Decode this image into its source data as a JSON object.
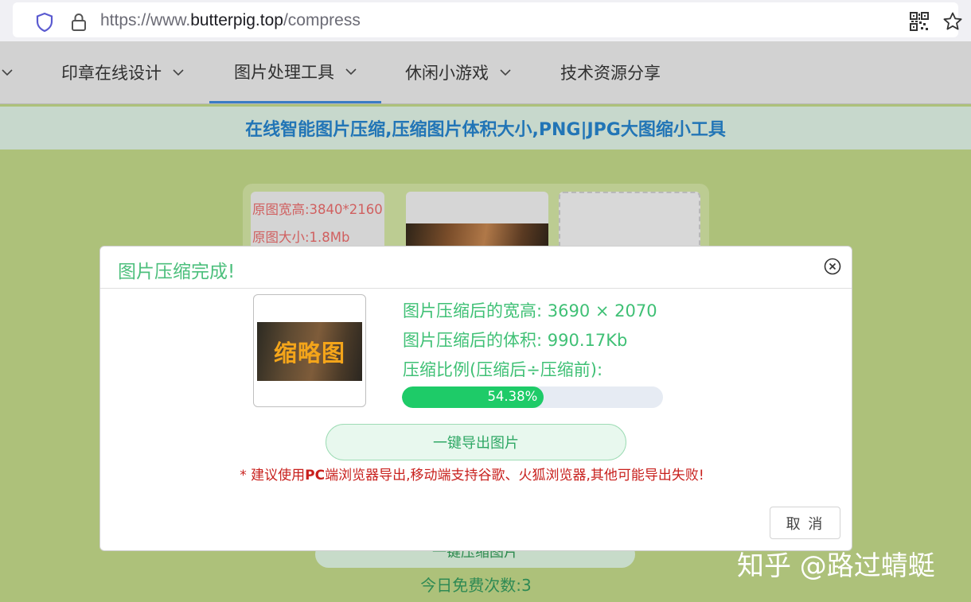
{
  "browser": {
    "url_scheme": "https://www.",
    "url_domain": "butterpig.top",
    "url_path": "/compress"
  },
  "nav": {
    "items": [
      {
        "label": "印章在线设计",
        "has_dropdown": true
      },
      {
        "label": "图片处理工具",
        "has_dropdown": true,
        "active": true
      },
      {
        "label": "休闲小游戏",
        "has_dropdown": true
      },
      {
        "label": "技术资源分享",
        "has_dropdown": false
      }
    ]
  },
  "page_title": "在线智能图片压缩,压缩图片体积大小,PNG|JPG大图缩小工具",
  "original_info": {
    "size_line": "原图宽高:3840*2160",
    "filesize_line": "原图大小:1.8Mb"
  },
  "background": {
    "compress_button": "一键压缩图片",
    "free_count": "今日免费次数:3"
  },
  "watermark": "知乎 @路过蜻蜓",
  "modal": {
    "title": "图片压缩完成!",
    "thumbnail_text": "缩略图",
    "dim_label": "图片压缩后的宽高:",
    "dim_value": "3690 × 2070",
    "size_label": "图片压缩后的体积:",
    "size_value": "990.17Kb",
    "ratio_label": "压缩比例(压缩后÷压缩前):",
    "ratio_value": 54.38,
    "ratio_text": "54.38%",
    "export_button": "一键导出图片",
    "warning_star": "* 建议使用",
    "warning_bold": "PC",
    "warning_rest": "端浏览器导出,移动端支持谷歌、火狐浏览器,其他可能导出失败!",
    "cancel_button": "取 消"
  },
  "colors": {
    "accent_green": "#1ecb68",
    "title_blue": "#2275b6",
    "warning_red": "#c8201d",
    "page_bg": "#adc17a"
  }
}
